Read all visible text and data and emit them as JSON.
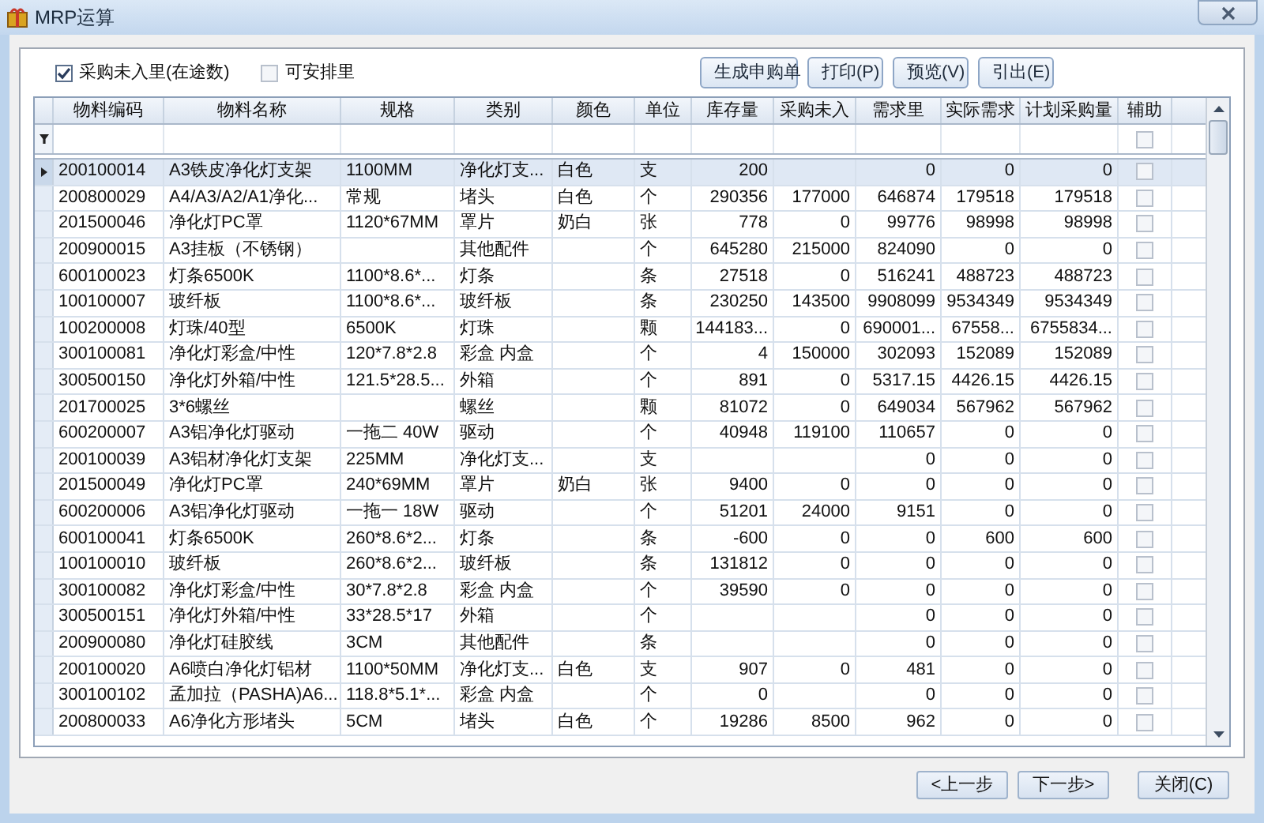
{
  "window": {
    "title": "MRP运算"
  },
  "options": [
    {
      "label": "采购未入里(在途数)",
      "checked": true
    },
    {
      "label": "可安排里",
      "checked": false
    }
  ],
  "toolbar": [
    "生成申购单",
    "打印(P)",
    "预览(V)",
    "引出(E)"
  ],
  "table": {
    "columns": [
      "物料编码",
      "物料名称",
      "规格",
      "类别",
      "颜色",
      "单位",
      "库存量",
      "采购未入",
      "需求里",
      "实际需求",
      "计划采购量",
      "辅助"
    ],
    "filter_aux_checked": false,
    "rows": [
      {
        "selected": true,
        "aux_checked": false,
        "cells": [
          "200100014",
          "A3铁皮净化灯支架",
          "1100MM",
          "净化灯支...",
          "白色",
          "支",
          "200",
          null,
          "0",
          "0",
          "0"
        ]
      },
      {
        "selected": false,
        "aux_checked": false,
        "cells": [
          "200800029",
          "A4/A3/A2/A1净化...",
          "常规",
          "堵头",
          "白色",
          "个",
          "290356",
          "177000",
          "646874",
          "179518",
          "179518"
        ]
      },
      {
        "selected": false,
        "aux_checked": false,
        "cells": [
          "201500046",
          "净化灯PC罩",
          "1120*67MM",
          "罩片",
          "奶白",
          "张",
          "778",
          "0",
          "99776",
          "98998",
          "98998"
        ]
      },
      {
        "selected": false,
        "aux_checked": false,
        "cells": [
          "200900015",
          "A3挂板（不锈钢）",
          null,
          "其他配件",
          null,
          "个",
          "645280",
          "215000",
          "824090",
          "0",
          "0"
        ]
      },
      {
        "selected": false,
        "aux_checked": false,
        "cells": [
          "600100023",
          "灯条6500K",
          "1100*8.6*...",
          "灯条",
          null,
          "条",
          "27518",
          "0",
          "516241",
          "488723",
          "488723"
        ]
      },
      {
        "selected": false,
        "aux_checked": false,
        "cells": [
          "100100007",
          "玻纤板",
          "1100*8.6*...",
          "玻纤板",
          null,
          "条",
          "230250",
          "143500",
          "9908099",
          "9534349",
          "9534349"
        ]
      },
      {
        "selected": false,
        "aux_checked": false,
        "cells": [
          "100200008",
          "灯珠/40型",
          "6500K",
          "灯珠",
          null,
          "颗",
          "144183...",
          "0",
          "690001...",
          "67558...",
          "6755834..."
        ]
      },
      {
        "selected": false,
        "aux_checked": false,
        "cells": [
          "300100081",
          "净化灯彩盒/中性",
          "120*7.8*2.8",
          "彩盒 内盒",
          null,
          "个",
          "4",
          "150000",
          "302093",
          "152089",
          "152089"
        ]
      },
      {
        "selected": false,
        "aux_checked": false,
        "cells": [
          "300500150",
          "净化灯外箱/中性",
          "121.5*28.5...",
          "外箱",
          null,
          "个",
          "891",
          "0",
          "5317.15",
          "4426.15",
          "4426.15"
        ]
      },
      {
        "selected": false,
        "aux_checked": false,
        "cells": [
          "201700025",
          "3*6螺丝",
          null,
          "螺丝",
          null,
          "颗",
          "81072",
          "0",
          "649034",
          "567962",
          "567962"
        ]
      },
      {
        "selected": false,
        "aux_checked": false,
        "cells": [
          "600200007",
          "A3铝净化灯驱动",
          "一拖二 40W",
          "驱动",
          null,
          "个",
          "40948",
          "119100",
          "110657",
          "0",
          "0"
        ]
      },
      {
        "selected": false,
        "aux_checked": false,
        "cells": [
          "200100039",
          "A3铝材净化灯支架",
          "225MM",
          "净化灯支...",
          null,
          "支",
          null,
          null,
          "0",
          "0",
          "0"
        ]
      },
      {
        "selected": false,
        "aux_checked": false,
        "cells": [
          "201500049",
          "净化灯PC罩",
          "240*69MM",
          "罩片",
          "奶白",
          "张",
          "9400",
          "0",
          "0",
          "0",
          "0"
        ]
      },
      {
        "selected": false,
        "aux_checked": false,
        "cells": [
          "600200006",
          "A3铝净化灯驱动",
          "一拖一 18W",
          "驱动",
          null,
          "个",
          "51201",
          "24000",
          "9151",
          "0",
          "0"
        ]
      },
      {
        "selected": false,
        "aux_checked": false,
        "cells": [
          "600100041",
          "灯条6500K",
          "260*8.6*2...",
          "灯条",
          null,
          "条",
          "-600",
          "0",
          "0",
          "600",
          "600"
        ]
      },
      {
        "selected": false,
        "aux_checked": false,
        "cells": [
          "100100010",
          "玻纤板",
          "260*8.6*2...",
          "玻纤板",
          null,
          "条",
          "131812",
          "0",
          "0",
          "0",
          "0"
        ]
      },
      {
        "selected": false,
        "aux_checked": false,
        "cells": [
          "300100082",
          "净化灯彩盒/中性",
          "30*7.8*2.8",
          "彩盒 内盒",
          null,
          "个",
          "39590",
          "0",
          "0",
          "0",
          "0"
        ]
      },
      {
        "selected": false,
        "aux_checked": false,
        "cells": [
          "300500151",
          "净化灯外箱/中性",
          "33*28.5*17",
          "外箱",
          null,
          "个",
          null,
          null,
          "0",
          "0",
          "0"
        ]
      },
      {
        "selected": false,
        "aux_checked": false,
        "cells": [
          "200900080",
          "净化灯硅胶线",
          "3CM",
          "其他配件",
          null,
          "条",
          null,
          null,
          "0",
          "0",
          "0"
        ]
      },
      {
        "selected": false,
        "aux_checked": false,
        "cells": [
          "200100020",
          "A6喷白净化灯铝材",
          "1100*50MM",
          "净化灯支...",
          "白色",
          "支",
          "907",
          "0",
          "481",
          "0",
          "0"
        ]
      },
      {
        "selected": false,
        "aux_checked": false,
        "cells": [
          "300100102",
          "孟加拉（PASHA)A6...",
          "118.8*5.1*...",
          "彩盒 内盒",
          null,
          "个",
          "0",
          null,
          "0",
          "0",
          "0"
        ]
      },
      {
        "selected": false,
        "aux_checked": false,
        "cells": [
          "200800033",
          "A6净化方形堵头",
          "5CM",
          "堵头",
          "白色",
          "个",
          "19286",
          "8500",
          "962",
          "0",
          "0"
        ]
      }
    ]
  },
  "footer_buttons": [
    "<上一步",
    "下一步>",
    "关闭(C)"
  ]
}
